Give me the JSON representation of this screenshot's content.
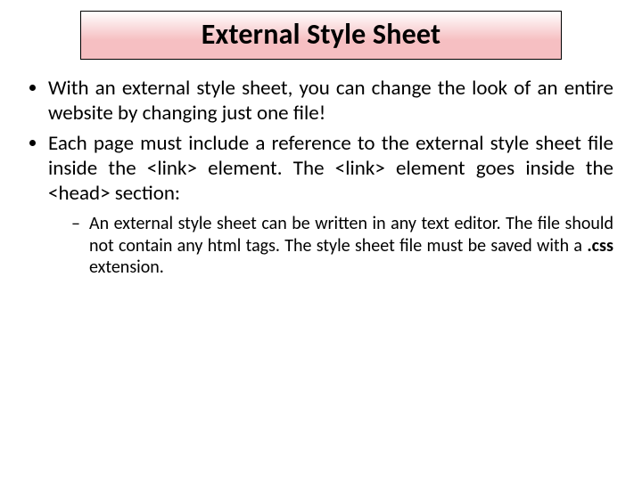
{
  "title": "External Style Sheet",
  "bullets": [
    "With an external style sheet, you can change the look of an entire website by changing just one file!",
    "Each page must include a reference to the external style sheet file inside the <link> element. The <link> element goes inside the <head> section:"
  ],
  "sub": {
    "pre": "An external style sheet can be written in any text editor. The file should not contain any html tags. The style sheet file must be saved with a ",
    "bold": ".css",
    "post": " extension."
  }
}
